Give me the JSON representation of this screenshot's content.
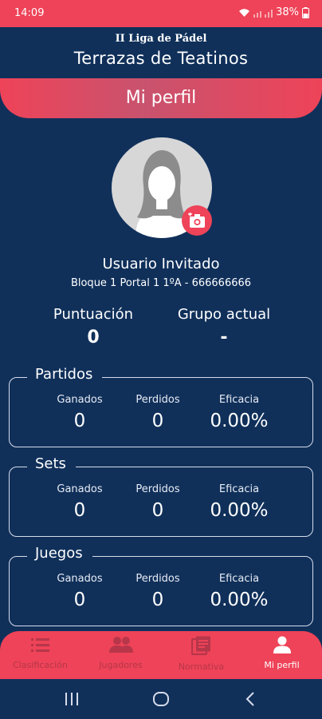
{
  "status": {
    "time": "14:09",
    "battery": "38%"
  },
  "header": {
    "subtitle": "II Liga de Pádel",
    "title": "Terrazas de Teatinos"
  },
  "page": {
    "title": "Mi perfil"
  },
  "user": {
    "name": "Usuario Invitado",
    "address": "Bloque 1 Portal 1 1ºA - 666666666"
  },
  "stats": {
    "score_label": "Puntuación",
    "score_value": "0",
    "group_label": "Grupo actual",
    "group_value": "-"
  },
  "cards": [
    {
      "title": "Partidos",
      "won_label": "Ganados",
      "won": "0",
      "lost_label": "Perdidos",
      "lost": "0",
      "eff_label": "Eficacia",
      "eff": "0.00%"
    },
    {
      "title": "Sets",
      "won_label": "Ganados",
      "won": "0",
      "lost_label": "Perdidos",
      "lost": "0",
      "eff_label": "Eficacia",
      "eff": "0.00%"
    },
    {
      "title": "Juegos",
      "won_label": "Ganados",
      "won": "0",
      "lost_label": "Perdidos",
      "lost": "0",
      "eff_label": "Eficacia",
      "eff": "0.00%"
    }
  ],
  "nav": [
    {
      "label": "Clasificación",
      "icon": "list-icon"
    },
    {
      "label": "Jugadores",
      "icon": "people-icon"
    },
    {
      "label": "Normativa",
      "icon": "document-icon"
    },
    {
      "label": "Mi perfil",
      "icon": "person-icon",
      "active": true
    }
  ],
  "colors": {
    "accent": "#ee4358",
    "background": "#10305a"
  }
}
